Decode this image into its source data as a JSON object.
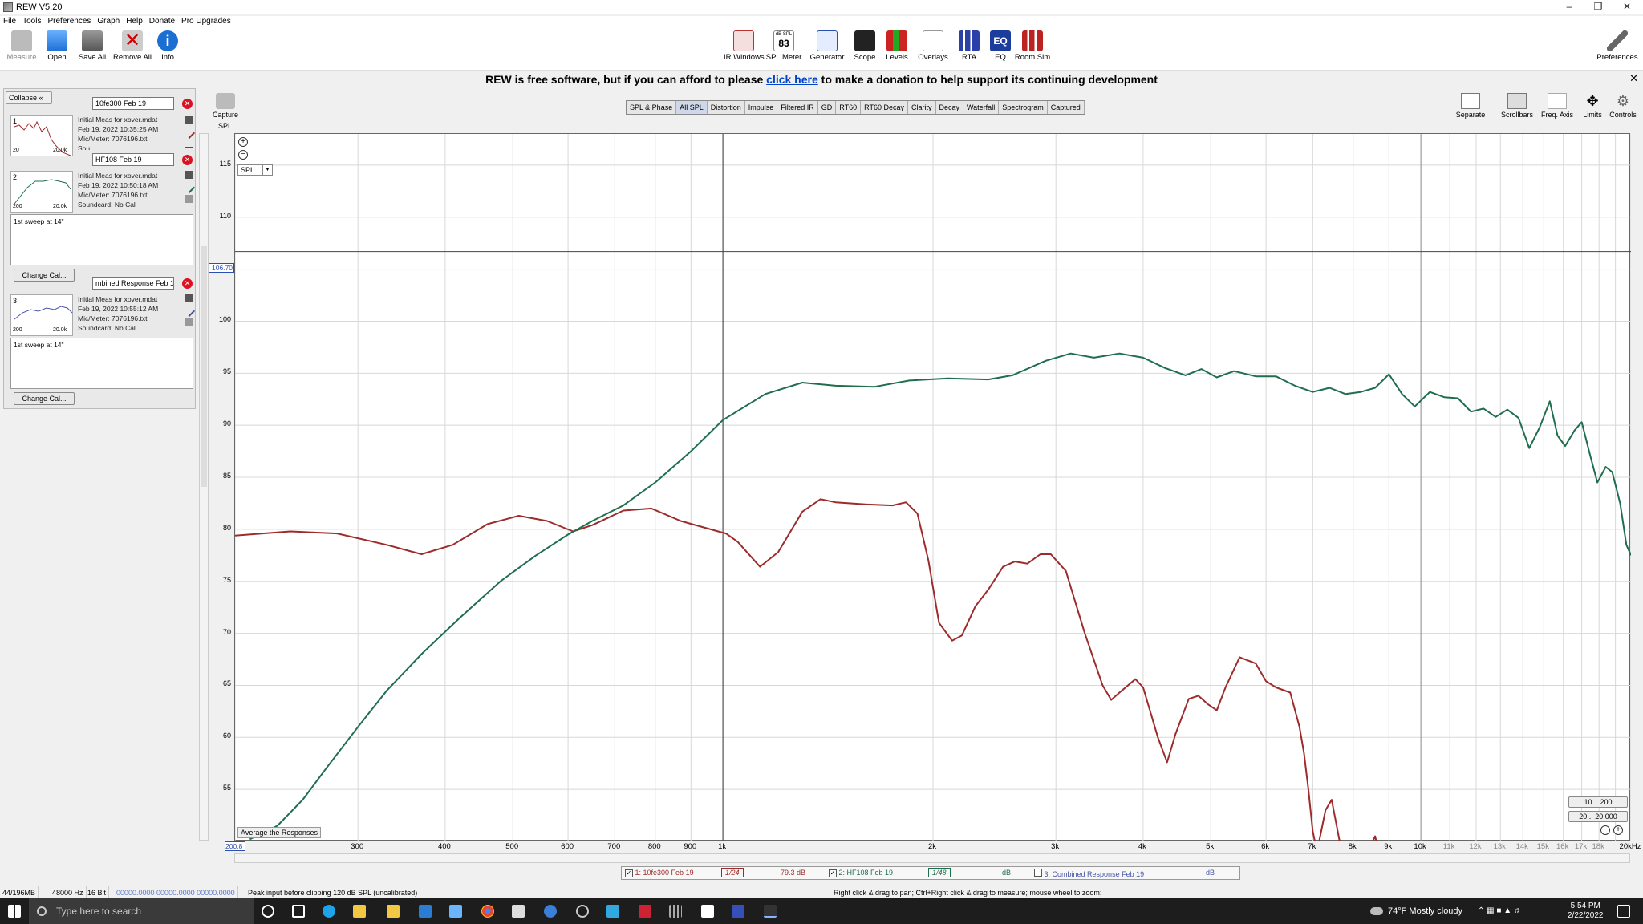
{
  "window": {
    "title": "REW V5.20"
  },
  "menu": [
    "File",
    "Tools",
    "Preferences",
    "Graph",
    "Help",
    "Donate",
    "Pro Upgrades"
  ],
  "toolbar_left": [
    {
      "label": "Measure",
      "icon": "microphone-icon"
    },
    {
      "label": "Open",
      "icon": "folder-icon"
    },
    {
      "label": "Save All",
      "icon": "save-icon"
    },
    {
      "label": "Remove All",
      "icon": "remove-icon"
    },
    {
      "label": "Info",
      "icon": "info-icon"
    }
  ],
  "toolbar_center": [
    {
      "label": "IR Windows",
      "icon": "ir-windows-icon"
    },
    {
      "label": "SPL Meter",
      "icon": "spl-meter-icon",
      "value": "83",
      "unit": "dB SPL"
    },
    {
      "label": "Generator",
      "icon": "generator-icon"
    },
    {
      "label": "Scope",
      "icon": "scope-icon"
    },
    {
      "label": "Levels",
      "icon": "levels-icon"
    },
    {
      "label": "Overlays",
      "icon": "overlays-icon"
    },
    {
      "label": "RTA",
      "icon": "rta-icon"
    },
    {
      "label": "EQ",
      "icon": "eq-icon"
    },
    {
      "label": "Room Sim",
      "icon": "room-sim-icon"
    }
  ],
  "toolbar_right": {
    "label": "Preferences",
    "icon": "wrench-icon"
  },
  "banner": {
    "before": "REW is free software, but if you can afford to please ",
    "link": "click here",
    "after": " to make a donation to help support its continuing development"
  },
  "left_panel": {
    "collapse_label": "Collapse",
    "measurements": [
      {
        "num": "1",
        "name": "10fe300 Feb 19",
        "info": [
          "Initial Meas for xover.mdat",
          "Feb 19, 2022 10:35:25 AM",
          "Mic/Meter: 7076196.txt",
          "Sou"
        ],
        "thumb_x": [
          "20",
          "20.0k"
        ],
        "color": "#a32a2a"
      },
      {
        "num": "2",
        "name": "HF108 Feb 19",
        "info": [
          "Initial Meas for xover.mdat",
          "Feb 19, 2022 10:50:18 AM",
          "Mic/Meter: 7076196.txt",
          "Soundcard: No Cal"
        ],
        "thumb_x": [
          "200",
          "20.0k"
        ],
        "notes": "1st sweep at 14\"",
        "change_cal": "Change Cal...",
        "color": "#1f6e4e"
      },
      {
        "num": "3",
        "name": "mbined Response Feb 19",
        "info": [
          "Initial Meas for xover.mdat",
          "Feb 19, 2022 10:55:12 AM",
          "Mic/Meter: 7076196.txt",
          "Soundcard: No Cal"
        ],
        "thumb_x": [
          "200",
          "20.0k"
        ],
        "notes": "1st sweep at 14\"",
        "change_cal": "Change Cal...",
        "color": "#4455aa"
      }
    ]
  },
  "graph_tabs": [
    "SPL & Phase",
    "All SPL",
    "Distortion",
    "Impulse",
    "Filtered IR",
    "GD",
    "RT60",
    "RT60 Decay",
    "Clarity",
    "Decay",
    "Waterfall",
    "Spectrogram",
    "Captured"
  ],
  "active_tab": "All SPL",
  "capture": {
    "label": "Capture"
  },
  "right_tools": [
    {
      "label": "Separate",
      "icon": "separate-icon"
    },
    {
      "label": "Scrollbars",
      "icon": "scrollbars-icon"
    },
    {
      "label": "Freq. Axis",
      "icon": "freq-axis-icon"
    },
    {
      "label": "Limits",
      "icon": "limits-icon"
    },
    {
      "label": "Controls",
      "icon": "controls-icon"
    }
  ],
  "plot": {
    "y_axis_label": "SPL",
    "y_select": "SPL",
    "cursor_value": "106.70",
    "x_start_value": "200.8",
    "average_button": "Average the Responses",
    "range_buttons": [
      "10 .. 200",
      "20 .. 20,000"
    ],
    "x_unit": "Hz"
  },
  "chart_data": {
    "type": "line",
    "xscale": "log",
    "xlim": [
      200,
      20000
    ],
    "ylim": [
      50,
      118
    ],
    "y_ticks": [
      55,
      60,
      65,
      70,
      75,
      80,
      85,
      90,
      95,
      100,
      105,
      110,
      115
    ],
    "x_ticks": [
      {
        "v": 300,
        "t": "300"
      },
      {
        "v": 400,
        "t": "400"
      },
      {
        "v": 500,
        "t": "500"
      },
      {
        "v": 600,
        "t": "600"
      },
      {
        "v": 700,
        "t": "700"
      },
      {
        "v": 800,
        "t": "800"
      },
      {
        "v": 900,
        "t": "900"
      },
      {
        "v": 1000,
        "t": "1k"
      },
      {
        "v": 2000,
        "t": "2k"
      },
      {
        "v": 3000,
        "t": "3k"
      },
      {
        "v": 4000,
        "t": "4k"
      },
      {
        "v": 5000,
        "t": "5k"
      },
      {
        "v": 6000,
        "t": "6k"
      },
      {
        "v": 7000,
        "t": "7k"
      },
      {
        "v": 8000,
        "t": "8k"
      },
      {
        "v": 9000,
        "t": "9k"
      },
      {
        "v": 10000,
        "t": "10k"
      },
      {
        "v": 11000,
        "t": "11k",
        "faint": true
      },
      {
        "v": 12000,
        "t": "12k",
        "faint": true
      },
      {
        "v": 13000,
        "t": "13k",
        "faint": true
      },
      {
        "v": 14000,
        "t": "14k",
        "faint": true
      },
      {
        "v": 15000,
        "t": "15k",
        "faint": true
      },
      {
        "v": 16000,
        "t": "16k",
        "faint": true
      },
      {
        "v": 17000,
        "t": "17k",
        "faint": true
      },
      {
        "v": 18000,
        "t": "18k",
        "faint": true
      },
      {
        "v": 20000,
        "t": "20kHz"
      }
    ],
    "cursor": {
      "x": 1000,
      "y": 106.7
    },
    "series": [
      {
        "name": "1: 10fe300 Feb 19",
        "color": "#9e2b2b",
        "points": [
          [
            200,
            79.4
          ],
          [
            240,
            79.8
          ],
          [
            280,
            79.6
          ],
          [
            330,
            78.5
          ],
          [
            370,
            77.6
          ],
          [
            410,
            78.5
          ],
          [
            460,
            80.5
          ],
          [
            510,
            81.3
          ],
          [
            560,
            80.8
          ],
          [
            610,
            79.8
          ],
          [
            650,
            80.4
          ],
          [
            720,
            81.8
          ],
          [
            790,
            82.0
          ],
          [
            870,
            80.8
          ],
          [
            960,
            80.0
          ],
          [
            1010,
            79.6
          ],
          [
            1050,
            78.8
          ],
          [
            1130,
            76.4
          ],
          [
            1200,
            77.8
          ],
          [
            1300,
            81.7
          ],
          [
            1380,
            82.9
          ],
          [
            1450,
            82.6
          ],
          [
            1600,
            82.4
          ],
          [
            1750,
            82.3
          ],
          [
            1830,
            82.6
          ],
          [
            1900,
            81.5
          ],
          [
            1970,
            77.0
          ],
          [
            2040,
            71.0
          ],
          [
            2130,
            69.3
          ],
          [
            2200,
            69.8
          ],
          [
            2300,
            72.6
          ],
          [
            2400,
            74.2
          ],
          [
            2520,
            76.4
          ],
          [
            2620,
            76.9
          ],
          [
            2730,
            76.7
          ],
          [
            2850,
            77.6
          ],
          [
            2950,
            77.6
          ],
          [
            3100,
            76.0
          ],
          [
            3300,
            70.0
          ],
          [
            3500,
            65.0
          ],
          [
            3600,
            63.6
          ],
          [
            3700,
            64.3
          ],
          [
            3900,
            65.6
          ],
          [
            4000,
            64.8
          ],
          [
            4200,
            60.0
          ],
          [
            4330,
            57.6
          ],
          [
            4450,
            60.3
          ],
          [
            4650,
            63.7
          ],
          [
            4800,
            64.0
          ],
          [
            4950,
            63.2
          ],
          [
            5100,
            62.6
          ],
          [
            5250,
            64.8
          ],
          [
            5500,
            67.7
          ],
          [
            5800,
            67.1
          ],
          [
            6000,
            65.4
          ],
          [
            6200,
            64.8
          ],
          [
            6500,
            64.3
          ],
          [
            6700,
            61.0
          ],
          [
            6800,
            58.5
          ],
          [
            6900,
            55.0
          ],
          [
            7000,
            51.0
          ],
          [
            7100,
            49.0
          ],
          [
            7300,
            53.0
          ],
          [
            7450,
            54.0
          ],
          [
            7550,
            52.0
          ],
          [
            7700,
            49.0
          ],
          [
            8400,
            49.0
          ],
          [
            8600,
            50.5
          ],
          [
            8700,
            49.0
          ]
        ]
      },
      {
        "name": "2: HF108 Feb 19",
        "color": "#1f6e4e",
        "points": [
          [
            210,
            50.2
          ],
          [
            230,
            51.5
          ],
          [
            250,
            54.0
          ],
          [
            270,
            57.0
          ],
          [
            300,
            61.0
          ],
          [
            330,
            64.5
          ],
          [
            370,
            68.0
          ],
          [
            420,
            71.5
          ],
          [
            480,
            75.0
          ],
          [
            540,
            77.5
          ],
          [
            600,
            79.5
          ],
          [
            650,
            80.8
          ],
          [
            720,
            82.3
          ],
          [
            800,
            84.5
          ],
          [
            900,
            87.5
          ],
          [
            1000,
            90.5
          ],
          [
            1150,
            93.0
          ],
          [
            1300,
            94.1
          ],
          [
            1450,
            93.8
          ],
          [
            1650,
            93.7
          ],
          [
            1850,
            94.3
          ],
          [
            2100,
            94.5
          ],
          [
            2400,
            94.4
          ],
          [
            2600,
            94.8
          ],
          [
            2900,
            96.2
          ],
          [
            3150,
            96.9
          ],
          [
            3400,
            96.5
          ],
          [
            3700,
            96.9
          ],
          [
            4000,
            96.5
          ],
          [
            4300,
            95.5
          ],
          [
            4600,
            94.8
          ],
          [
            4850,
            95.4
          ],
          [
            5100,
            94.6
          ],
          [
            5400,
            95.2
          ],
          [
            5800,
            94.7
          ],
          [
            6200,
            94.7
          ],
          [
            6600,
            93.8
          ],
          [
            7000,
            93.2
          ],
          [
            7400,
            93.6
          ],
          [
            7800,
            93.0
          ],
          [
            8200,
            93.2
          ],
          [
            8600,
            93.6
          ],
          [
            9000,
            94.9
          ],
          [
            9400,
            93.0
          ],
          [
            9800,
            91.8
          ],
          [
            10300,
            93.2
          ],
          [
            10800,
            92.7
          ],
          [
            11300,
            92.6
          ],
          [
            11800,
            91.3
          ],
          [
            12300,
            91.6
          ],
          [
            12800,
            90.8
          ],
          [
            13300,
            91.5
          ],
          [
            13800,
            90.7
          ],
          [
            14300,
            87.8
          ],
          [
            14800,
            89.8
          ],
          [
            15300,
            92.3
          ],
          [
            15700,
            89.0
          ],
          [
            16100,
            88.0
          ],
          [
            16600,
            89.5
          ],
          [
            17000,
            90.3
          ],
          [
            17500,
            87.0
          ],
          [
            17900,
            84.5
          ],
          [
            18400,
            86.0
          ],
          [
            18800,
            85.5
          ],
          [
            19300,
            82.5
          ],
          [
            19700,
            78.5
          ],
          [
            20000,
            77.5
          ]
        ]
      }
    ]
  },
  "legend": [
    {
      "checked": true,
      "name": "1: 10fe300 Feb 19",
      "smoothing": "1/24",
      "value": "79.3 dB",
      "color": "#9e2b2b"
    },
    {
      "checked": true,
      "name": "2: HF108 Feb 19",
      "smoothing": "1/48",
      "value": "dB",
      "color": "#1f6e4e"
    },
    {
      "checked": false,
      "name": "3: Combined Response Feb 19",
      "value": "dB",
      "color": "#4455aa"
    }
  ],
  "status": {
    "memory": "44/196MB",
    "rate": "48000 Hz",
    "bits": "16 Bit",
    "levels": "00000.0000 00000.0000 00000.0000",
    "clip": "Peak input before clipping 120 dB SPL (uncalibrated)",
    "hint": "Right click & drag to pan; Ctrl+Right click & drag to measure; mouse wheel to zoom;"
  },
  "taskbar": {
    "search_placeholder": "Type here to search",
    "weather": "74°F  Mostly cloudy",
    "time": "5:54 PM",
    "date": "2/22/2022"
  }
}
